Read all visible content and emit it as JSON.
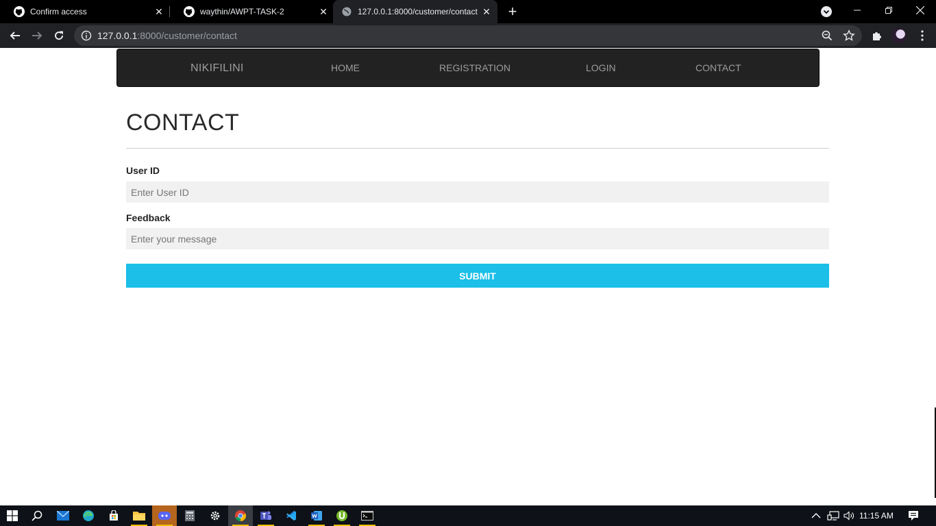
{
  "browser": {
    "tabs": [
      {
        "title": "Confirm access",
        "icon": "github-icon"
      },
      {
        "title": "waythin/AWPT-TASK-2",
        "icon": "github-icon"
      },
      {
        "title": "127.0.0.1:8000/customer/contact",
        "icon": "globe-icon",
        "active": true
      }
    ],
    "url_host": "127.0.0.1",
    "url_rest": ":8000/customer/contact"
  },
  "site": {
    "brand": "NIKIFILINI",
    "nav": [
      "HOME",
      "REGISTRATION",
      "LOGIN",
      "CONTACT"
    ]
  },
  "form": {
    "title": "CONTACT",
    "user_id_label": "User ID",
    "user_id_placeholder": "Enter User ID",
    "feedback_label": "Feedback",
    "feedback_placeholder": "Enter your message",
    "submit_label": "SUBMIT"
  },
  "taskbar": {
    "time": "11:15 AM",
    "apps": [
      "windows-start",
      "search",
      "mail",
      "edge",
      "store",
      "file-explorer",
      "discord",
      "calculator",
      "settings",
      "chrome",
      "teams",
      "vscode",
      "word",
      "utorrent",
      "terminal"
    ]
  },
  "colors": {
    "accent": "#1bbfe8",
    "navbar": "#222222",
    "field_bg": "#f1f1f1"
  }
}
